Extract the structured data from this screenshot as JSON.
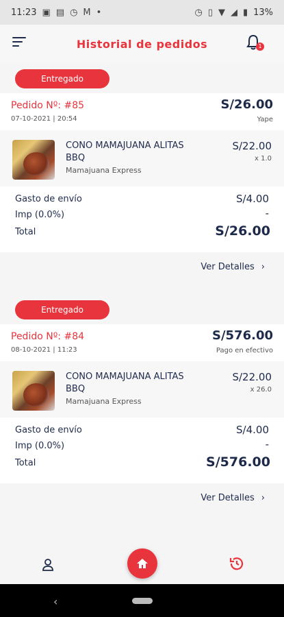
{
  "status_bar": {
    "time": "11:23",
    "battery": "13%",
    "icons": [
      "image-icon",
      "document-icon",
      "alarm-icon",
      "mail-icon",
      "dot-icon",
      "alarm-icon",
      "vibrate-icon",
      "wifi-icon",
      "signal-icon",
      "battery-icon"
    ]
  },
  "header": {
    "title": "Historial de pedidos",
    "notification_count": "1"
  },
  "orders": [
    {
      "status": "Entregado",
      "number": "Pedido Nº: #85",
      "date": "07-10-2021 | 20:54",
      "total": "S/26.00",
      "payment": "Yape",
      "item": {
        "name": "CONO MAMAJUANA ALITAS BBQ",
        "restaurant": "Mamajuana Express",
        "price": "S/22.00",
        "qty": "x 1.0"
      },
      "summary": {
        "shipping_label": "Gasto de envío",
        "shipping_value": "S/4.00",
        "tax_label": "Imp (0.0%)",
        "tax_value": "-",
        "total_label": "Total",
        "total_value": "S/26.00"
      },
      "details_label": "Ver Detalles"
    },
    {
      "status": "Entregado",
      "number": "Pedido Nº: #84",
      "date": "08-10-2021 | 11:23",
      "total": "S/576.00",
      "payment": "Pago en efectivo",
      "item": {
        "name": "CONO MAMAJUANA ALITAS BBQ",
        "restaurant": "Mamajuana Express",
        "price": "S/22.00",
        "qty": "x 26.0"
      },
      "summary": {
        "shipping_label": "Gasto de envío",
        "shipping_value": "S/4.00",
        "tax_label": "Imp (0.0%)",
        "tax_value": "-",
        "total_label": "Total",
        "total_value": "S/576.00"
      },
      "details_label": "Ver Detalles"
    }
  ],
  "bottom_nav": {
    "items": [
      "profile",
      "home",
      "history"
    ],
    "active": "history"
  },
  "colors": {
    "accent": "#e8343c",
    "text_primary": "#1e2a4a",
    "background": "#f5f5f5"
  }
}
